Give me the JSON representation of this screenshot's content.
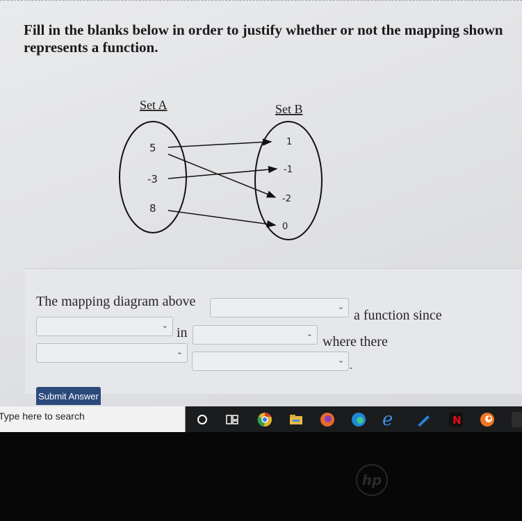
{
  "question": {
    "text": "Fill in the blanks below in order to justify whether or not the mapping shown represents a function."
  },
  "diagram": {
    "set_a_label": "Set A",
    "set_b_label": "Set B",
    "set_a": [
      "5",
      "-3",
      "8"
    ],
    "set_b": [
      "1",
      "-1",
      "-2",
      "0"
    ],
    "mappings": [
      [
        "5",
        "1"
      ],
      [
        "5",
        "-2"
      ],
      [
        "-3",
        "-1"
      ],
      [
        "8",
        "0"
      ]
    ]
  },
  "answer": {
    "sentence_1": "The mapping diagram above",
    "sentence_2": "a function since",
    "word_in": "in",
    "sentence_3": "where there",
    "period": ".",
    "dropdowns": [
      "",
      "",
      "",
      "",
      ""
    ]
  },
  "submit_label": "Submit Answer",
  "taskbar": {
    "search_placeholder": "Type here to search",
    "icons": [
      "cortana-icon",
      "task-view-icon",
      "chrome-icon",
      "file-explorer-icon",
      "firefox-icon",
      "edge-icon",
      "internet-explorer-icon",
      "pen-icon",
      "netflix-icon",
      "crunchyroll-icon"
    ]
  },
  "brand": "hp"
}
